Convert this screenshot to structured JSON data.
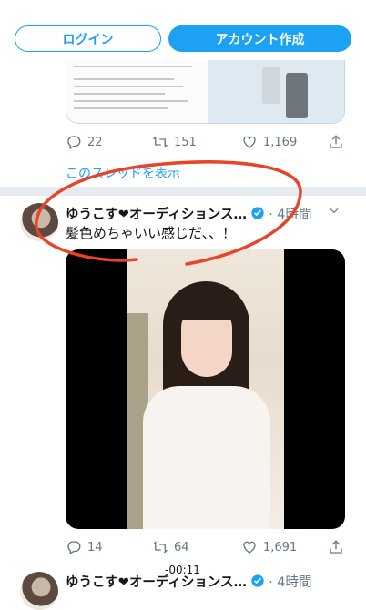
{
  "header": {
    "login_label": "ログイン",
    "signup_label": "アカウント作成"
  },
  "tweet1": {
    "replies": "22",
    "retweets": "151",
    "likes": "1,169",
    "show_thread": "このスレッドを表示"
  },
  "tweet2": {
    "name": "ゆうこす❤︎オーディションス…",
    "time": "· 4時間",
    "text": "髪色めちゃいい感じだ、、！",
    "video_timer": "-00:11",
    "replies": "14",
    "retweets": "64",
    "likes": "1,691"
  },
  "tweet3": {
    "name": "ゆうこす❤︎オーディションス…",
    "time": "· 4時間"
  },
  "colors": {
    "accent": "#1da1f2",
    "annotation": "#e8442a",
    "muted": "#657786"
  },
  "icons": [
    "reply-icon",
    "retweet-icon",
    "like-icon",
    "share-icon",
    "verified-icon",
    "chevron-down-icon"
  ]
}
